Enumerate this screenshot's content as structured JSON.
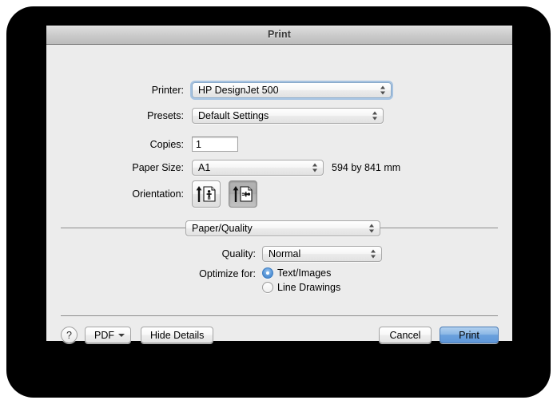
{
  "window": {
    "title": "Print"
  },
  "form": {
    "printer": {
      "label": "Printer:",
      "value": "HP DesignJet 500"
    },
    "presets": {
      "label": "Presets:",
      "value": "Default Settings"
    },
    "copies": {
      "label": "Copies:",
      "value": "1"
    },
    "paper_size": {
      "label": "Paper Size:",
      "value": "A1",
      "dimensions_note": "594 by 841 mm"
    },
    "orientation": {
      "label": "Orientation:",
      "options": [
        {
          "name": "portrait",
          "selected": false
        },
        {
          "name": "landscape",
          "selected": true
        }
      ]
    }
  },
  "pane": {
    "selector_value": "Paper/Quality",
    "quality": {
      "label": "Quality:",
      "value": "Normal"
    },
    "optimize": {
      "label": "Optimize for:",
      "options": [
        {
          "label": "Text/Images",
          "selected": true
        },
        {
          "label": "Line Drawings",
          "selected": false
        }
      ]
    }
  },
  "footer": {
    "help_label": "?",
    "pdf_label": "PDF",
    "details_label": "Hide Details",
    "cancel_label": "Cancel",
    "print_label": "Print"
  },
  "colors": {
    "accent": "#6ba1dd",
    "window_bg": "#ececec",
    "titlebar": "#c9c9c9",
    "separator": "#8d8d8d"
  }
}
